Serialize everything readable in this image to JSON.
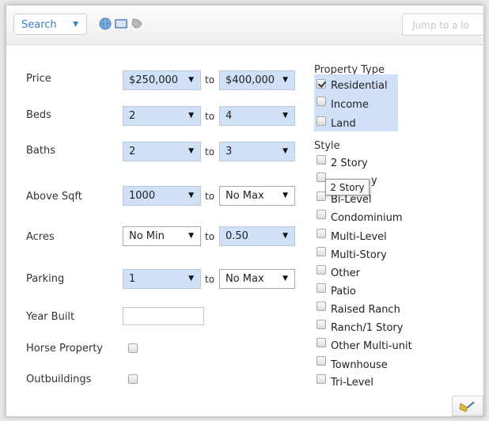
{
  "toolbar": {
    "search_label": "Search",
    "jump_placeholder": "Jump to a lo",
    "icons": [
      "globe-icon",
      "rectangle-icon",
      "lasso-icon"
    ]
  },
  "filters": {
    "price": {
      "label": "Price",
      "from": "$250,000",
      "to": "$400,000",
      "to_word": "to"
    },
    "beds": {
      "label": "Beds",
      "from": "2",
      "to": "4",
      "to_word": "to"
    },
    "baths": {
      "label": "Baths",
      "from": "2",
      "to": "3",
      "to_word": "to"
    },
    "sqft": {
      "label": "Above Sqft",
      "from": "1000",
      "to": "No Max",
      "to_word": "to"
    },
    "acres": {
      "label": "Acres",
      "from": "No Min",
      "to": "0.50",
      "to_word": "to"
    },
    "parking": {
      "label": "Parking",
      "from": "1",
      "to": "No Max",
      "to_word": "to"
    },
    "year_built": {
      "label": "Year Built",
      "value": ""
    },
    "horse": {
      "label": "Horse Property",
      "checked": false
    },
    "outbuildings": {
      "label": "Outbuildings",
      "checked": false
    }
  },
  "property_type": {
    "title": "Property Type",
    "options": [
      {
        "label": "Residential",
        "checked": true
      },
      {
        "label": "Income",
        "checked": false
      },
      {
        "label": "Land",
        "checked": false
      }
    ]
  },
  "style": {
    "title": "Style",
    "options": [
      {
        "label": "2 Story",
        "checked": false
      },
      {
        "label": "y",
        "checked": false
      },
      {
        "label": "Bi-Level",
        "checked": false
      },
      {
        "label": "Condominium",
        "checked": false
      },
      {
        "label": "Multi-Level",
        "checked": false
      },
      {
        "label": "Multi-Story",
        "checked": false
      },
      {
        "label": "Other",
        "checked": false
      },
      {
        "label": "Patio",
        "checked": false
      },
      {
        "label": "Raised Ranch",
        "checked": false
      },
      {
        "label": "Ranch/1 Story",
        "checked": false
      },
      {
        "label": "Other Multi-unit",
        "checked": false
      },
      {
        "label": "Townhouse",
        "checked": false
      },
      {
        "label": "Tri-Level",
        "checked": false
      }
    ]
  },
  "tooltip": "2 Story",
  "colors": {
    "accent": "#3a7fc4",
    "highlight": "#cfe0f7"
  },
  "corner_icon": "broom-icon"
}
